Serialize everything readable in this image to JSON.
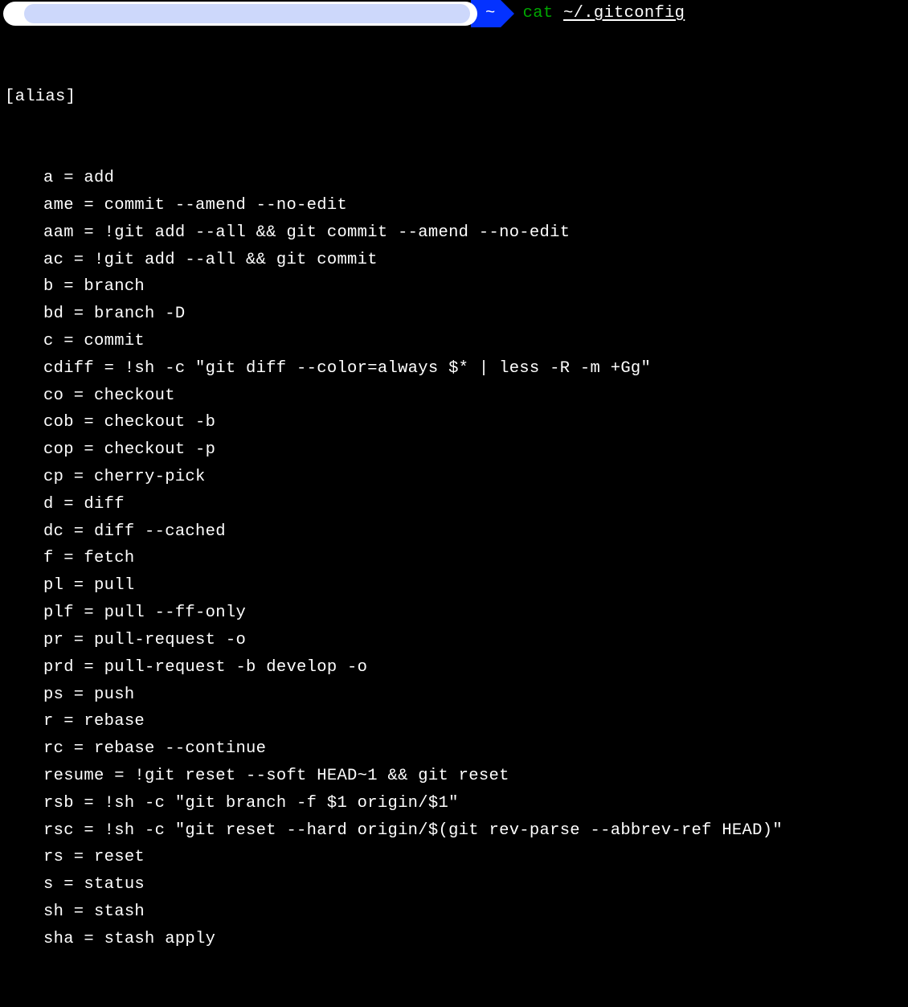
{
  "prompt": {
    "cwd": "~",
    "command": "cat",
    "argument": "~/.gitconfig"
  },
  "output": {
    "section": "[alias]",
    "lines": [
      "a = add",
      "ame = commit --amend --no-edit",
      "aam = !git add --all && git commit --amend --no-edit",
      "ac = !git add --all && git commit",
      "b = branch",
      "bd = branch -D",
      "c = commit",
      "cdiff = !sh -c \\\"git diff --color=always $* | less -R -m +Gg\\\"",
      "co = checkout",
      "cob = checkout -b",
      "cop = checkout -p",
      "cp = cherry-pick",
      "d = diff",
      "dc = diff --cached",
      "f = fetch",
      "pl = pull",
      "plf = pull --ff-only",
      "pr = pull-request -o",
      "prd = pull-request -b develop -o",
      "ps = push",
      "r = rebase",
      "rc = rebase --continue",
      "resume = !git reset --soft HEAD~1 && git reset",
      "rsb = !sh -c \\\"git branch -f $1 origin/$1\\\"",
      "rsc = !sh -c \\\"git reset --hard origin/$(git rev-parse --abbrev-ref HEAD)\\\"",
      "rs = reset",
      "s = status",
      "sh = stash",
      "sha = stash apply"
    ]
  }
}
